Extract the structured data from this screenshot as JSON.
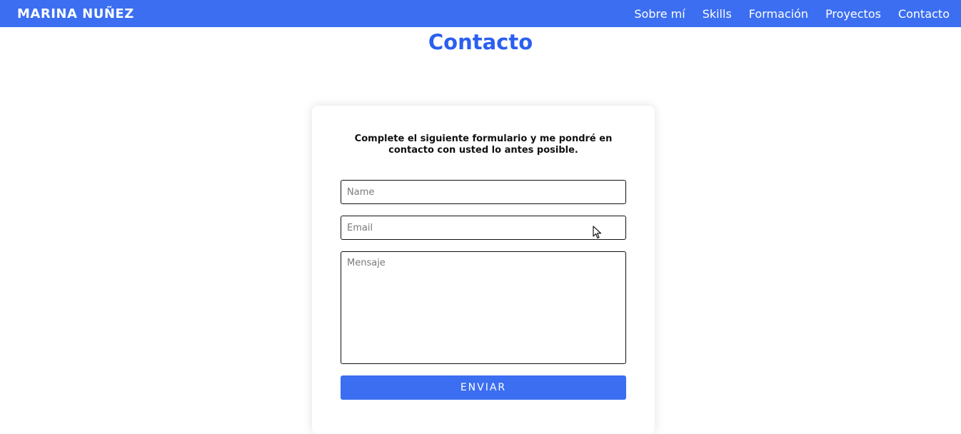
{
  "navbar": {
    "brand": "MARINA NUÑEZ",
    "links": [
      "Sobre mí",
      "Skills",
      "Formación",
      "Proyectos",
      "Contacto"
    ],
    "color": "#3b6ef1"
  },
  "page": {
    "title": "Contacto"
  },
  "form": {
    "intro": "Complete el siguiente formulario y me pondré en contacto con usted lo antes posible.",
    "name_placeholder": "Name",
    "email_placeholder": "Email",
    "message_placeholder": "Mensaje",
    "submit_label": "ENVIAR"
  },
  "cursor": {
    "icon": "mouse-pointer-icon"
  }
}
